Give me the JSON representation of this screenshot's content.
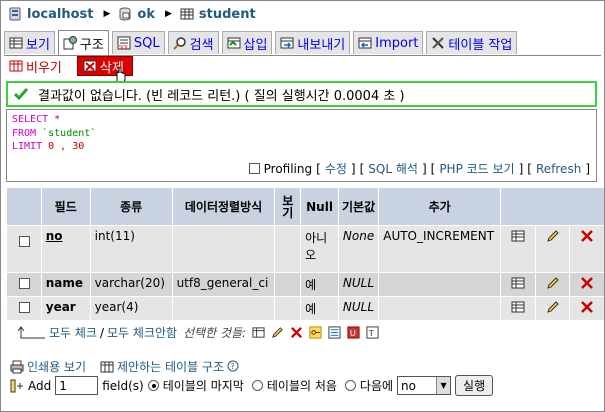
{
  "breadcrumb": {
    "server": "localhost",
    "database": "ok",
    "table": "student"
  },
  "tabs": [
    {
      "label": "보기"
    },
    {
      "label": "구조"
    },
    {
      "label": "SQL"
    },
    {
      "label": "검색"
    },
    {
      "label": "삽입"
    },
    {
      "label": "내보내기"
    },
    {
      "label": "Import"
    },
    {
      "label": "테이블 작업"
    }
  ],
  "subtabs": {
    "empty": "비우기",
    "drop": "삭제"
  },
  "message": "결과값이 없습니다. (빈 레코드 리턴.) ( 질의 실행시간 0.0004 초 )",
  "sql": {
    "select": "SELECT",
    "star": "*",
    "from": "FROM",
    "table": "`student`",
    "limit": "LIMIT",
    "limit_vals": "0 , 30"
  },
  "sql_options": {
    "profiling": "Profiling",
    "edit": "수정",
    "explain": "SQL 해석",
    "php": "PHP 코드 보기",
    "refresh": "Refresh"
  },
  "table": {
    "headers": {
      "field": "필드",
      "type": "종류",
      "collation": "데이터정렬방식",
      "attributes": "보기",
      "null": "Null",
      "default": "기본값",
      "extra": "추가"
    },
    "rows": [
      {
        "field": "no",
        "type": "int(11)",
        "collation": "",
        "null": "아니오",
        "default": "None",
        "extra": "AUTO_INCREMENT"
      },
      {
        "field": "name",
        "type": "varchar(20)",
        "collation": "utf8_general_ci",
        "null": "예",
        "default": "NULL",
        "extra": ""
      },
      {
        "field": "year",
        "type": "year(4)",
        "collation": "",
        "null": "예",
        "default": "NULL",
        "extra": ""
      }
    ]
  },
  "bulk": {
    "check_all": "모두 체크",
    "separator": "/",
    "uncheck_all": "모두 체크안함",
    "with_selected": "선택한 것들:"
  },
  "bottom": {
    "print_view": "인쇄용 보기",
    "propose": "제안하는 테이블 구조",
    "add": "Add",
    "add_count": "1",
    "fields": "field(s)",
    "at_end": "테이블의 마지막",
    "at_begin": "테이블의 처음",
    "after": "다음에",
    "after_select": "no",
    "go": "실행"
  },
  "colors": {
    "link": "#235a81",
    "header_bg": "#c8d2e0",
    "success_border": "#3bd13b",
    "drop_bg": "#dd0000"
  }
}
